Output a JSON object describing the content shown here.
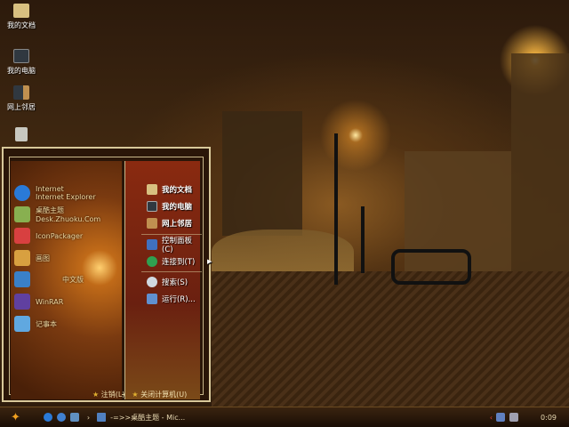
{
  "desktop_icons": [
    {
      "label": "我的文档",
      "icon": "folder-icon"
    },
    {
      "label": "我的电脑",
      "icon": "computer-icon"
    },
    {
      "label": "网上邻居",
      "icon": "network-icon"
    },
    {
      "label": "",
      "icon": "recycle-bin-icon"
    }
  ],
  "start_menu": {
    "programs": [
      {
        "title": "Internet",
        "subtitle": "Internet Explorer",
        "icon": "ie-icon",
        "color": "#2a7ad8"
      },
      {
        "title": "桌酷主题Desk.Zhuoku.Com",
        "icon": "zhuoku-icon",
        "color": "#88b050"
      },
      {
        "title": "IconPackager",
        "icon": "iconpackager-icon",
        "color": "#d84040"
      },
      {
        "title": "画图",
        "icon": "paint-icon",
        "color": "#d8a040"
      },
      {
        "title": "中文版",
        "icon": "app-icon",
        "color": "#3a80c8"
      },
      {
        "title": "WinRAR",
        "icon": "winrar-icon",
        "color": "#6040a0"
      },
      {
        "title": "记事本",
        "icon": "notepad-icon",
        "color": "#60a8e0"
      }
    ],
    "places": [
      {
        "label": "我的文档",
        "icon": "folder-icon",
        "color": "#d8c080"
      },
      {
        "label": "我的电脑",
        "icon": "computer-icon",
        "color": "#303840"
      },
      {
        "label": "网上邻居",
        "icon": "network-icon",
        "color": "#c09050"
      }
    ],
    "system": [
      {
        "label": "控制面板(C)",
        "icon": "control-panel-icon",
        "color": "#4070c0"
      },
      {
        "label": "连接到(T)",
        "icon": "globe-icon",
        "color": "#30a050"
      }
    ],
    "tools": [
      {
        "label": "搜索(S)",
        "icon": "search-icon",
        "color": "#d0d8e0"
      },
      {
        "label": "运行(R)...",
        "icon": "run-icon",
        "color": "#6090d0"
      }
    ],
    "logoff": "注销(L)",
    "shutdown": "关闭计算机(U)"
  },
  "taskbar": {
    "start_icon": "maple-leaf-icon",
    "task_label": "-=>>桌酷主题 - Mic...",
    "clock": "0:09"
  }
}
